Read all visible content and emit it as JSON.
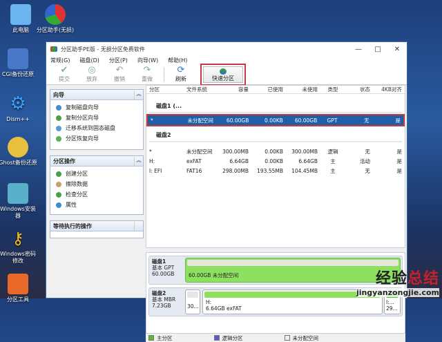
{
  "desktop": {
    "icons": [
      "此电脑",
      "分区助手(无损)",
      "CGI备份还原",
      "Dism++",
      "Ghost备份还原",
      "Windows安装器",
      "Windows密码修改",
      "分区工具"
    ]
  },
  "window": {
    "title": "分区助手PE版 - 无损分区免费软件",
    "controls": [
      "—",
      "□",
      "✕"
    ]
  },
  "menu": [
    "常规(G)",
    "磁盘(D)",
    "分区(P)",
    "向导(W)",
    "帮助(H)"
  ],
  "toolbar": {
    "buttons": [
      "提交",
      "放弃",
      "撤销",
      "重做",
      "刷新"
    ],
    "quick": "快速分区"
  },
  "left": {
    "wizard": {
      "title": "向导",
      "items": [
        "复制磁盘向导",
        "复制分区向导",
        "迁移系统到固态磁盘",
        "分区恢复向导"
      ]
    },
    "ops": {
      "title": "分区操作",
      "items": [
        "创建分区",
        "擦除数据",
        "检查分区",
        "属性"
      ]
    },
    "pending": {
      "title": "等待执行的操作"
    }
  },
  "table": {
    "headers": [
      "分区",
      "文件系统",
      "容量",
      "已使用",
      "未使用",
      "类型",
      "状态",
      "4KB对齐"
    ],
    "disk1": {
      "label": "磁盘1 (...",
      "rows": [
        [
          "*",
          "未分配空间",
          "60.00GB",
          "0.00KB",
          "60.00GB",
          "GPT",
          "无",
          "是"
        ]
      ]
    },
    "disk2": {
      "label": "磁盘2",
      "rows": [
        [
          "*",
          "未分配空间",
          "300.00MB",
          "0.00KB",
          "300.00MB",
          "逻辑",
          "无",
          "是"
        ],
        [
          "H:",
          "exFAT",
          "6.64GB",
          "0.00KB",
          "6.64GB",
          "主",
          "活动",
          "是"
        ],
        [
          "I: EFI",
          "FAT16",
          "298.00MB",
          "193.55MB",
          "104.45MB",
          "主",
          "无",
          "是"
        ]
      ]
    }
  },
  "graph": {
    "disk1": {
      "name": "磁盘1",
      "type": "基本 GPT",
      "size": "60.00GB",
      "part": "60.00GB 未分配空间"
    },
    "disk2": {
      "name": "磁盘2",
      "type": "基本 MBR",
      "size": "7.23GB",
      "p1": "30...",
      "p2a": "H:",
      "p2b": "6.64GB exFAT",
      "p3a": "I:...",
      "p3b": "29..."
    }
  },
  "legend": [
    "主分区",
    "逻辑分区",
    "未分配空间"
  ],
  "watermark": {
    "line1a": "经验",
    "line1b": "总结",
    "line2": "jingyanzongjie.com"
  }
}
